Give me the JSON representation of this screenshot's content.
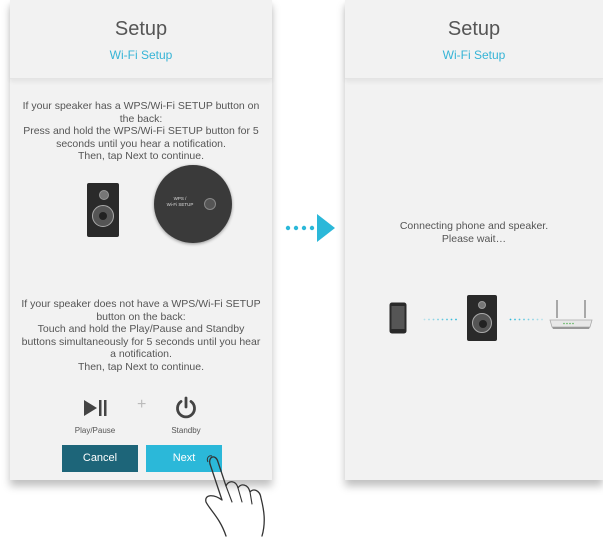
{
  "left_screen": {
    "title": "Setup",
    "subtitle": "Wi-Fi Setup",
    "wps_instruction": "If your speaker has a WPS/Wi-Fi SETUP button on the back:\nPress and hold the WPS/Wi-Fi SETUP button for 5 seconds until you hear a notification.\nThen, tap Next to continue.",
    "wps_button_label": "WPS /\nWi-Fi SETUP",
    "no_wps_instruction": "If your speaker does not have a WPS/Wi-Fi SETUP button on the back:\nTouch and hold the Play/Pause and Standby buttons simultaneously for 5 seconds until you hear a notification.\nThen, tap Next to continue.",
    "play_pause_label": "Play/Pause",
    "plus_symbol": "+",
    "standby_label": "Standby",
    "cancel_label": "Cancel",
    "next_label": "Next"
  },
  "right_screen": {
    "title": "Setup",
    "subtitle": "Wi-Fi Setup",
    "connecting_text": "Connecting phone and speaker.\nPlease wait…"
  },
  "colors": {
    "accent": "#2bb8d9",
    "cancel_button": "#1d6579",
    "subtitle": "#36b4d6"
  },
  "icons": [
    "speaker-icon",
    "wps-button-icon",
    "play-pause-icon",
    "standby-icon",
    "hand-tap-icon",
    "arrow-right-icon",
    "phone-icon",
    "router-icon"
  ]
}
